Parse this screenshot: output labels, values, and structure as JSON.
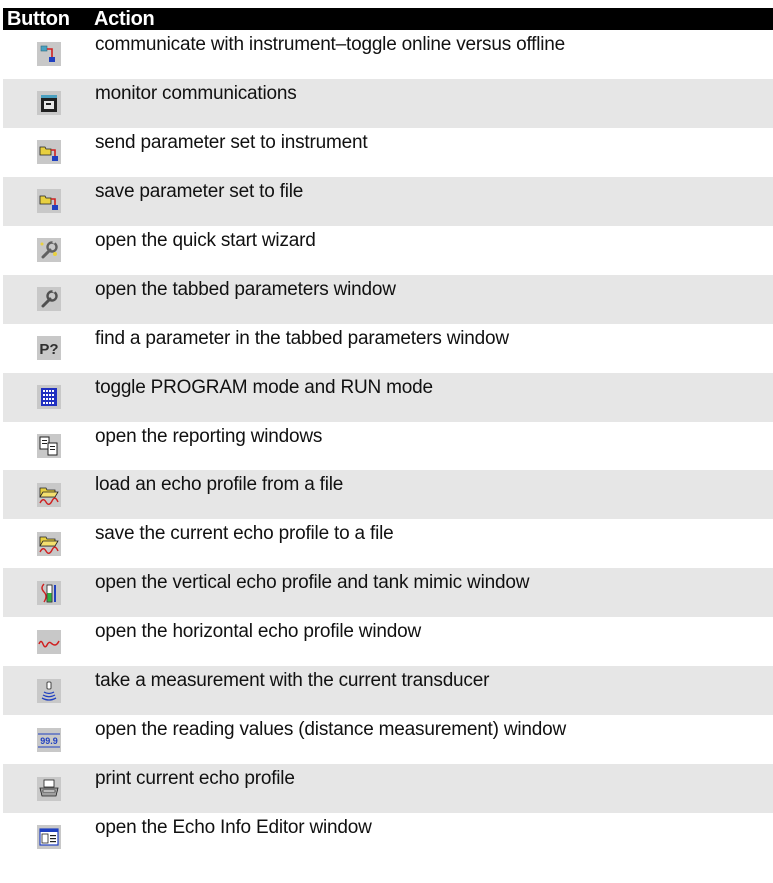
{
  "header": {
    "button": "Button",
    "action": "Action"
  },
  "rows": [
    {
      "icon": "online-toggle-icon",
      "text": "communicate with instrument–toggle online versus offline"
    },
    {
      "icon": "monitor-communications-icon",
      "text": "monitor communications"
    },
    {
      "icon": "send-parameters-icon",
      "text": "send parameter set to instrument"
    },
    {
      "icon": "save-parameters-icon",
      "text": "save parameter set to file"
    },
    {
      "icon": "quick-start-wizard-icon",
      "text": "open the quick start wizard"
    },
    {
      "icon": "wrench-icon",
      "text": "open the tabbed parameters window"
    },
    {
      "icon": "find-parameter-icon",
      "text": "find a parameter in the tabbed parameters window"
    },
    {
      "icon": "keypad-icon",
      "text": "toggle PROGRAM mode and RUN mode"
    },
    {
      "icon": "reporting-windows-icon",
      "text": "open the reporting windows"
    },
    {
      "icon": "load-echo-profile-icon",
      "text": "load an echo profile from a file"
    },
    {
      "icon": "save-echo-profile-icon",
      "text": "save the current echo profile to a file"
    },
    {
      "icon": "vertical-echo-profile-icon",
      "text": "open the vertical echo profile and tank mimic window"
    },
    {
      "icon": "horizontal-echo-profile-icon",
      "text": "open the horizontal echo profile window"
    },
    {
      "icon": "transducer-measurement-icon",
      "text": "take a measurement with the current transducer"
    },
    {
      "icon": "reading-values-icon",
      "text": "open the reading values (distance measurement) window"
    },
    {
      "icon": "printer-icon",
      "text": "print current echo profile"
    },
    {
      "icon": "echo-info-editor-icon",
      "text": "open the Echo Info Editor window"
    }
  ],
  "icon_texts": {
    "find_parameter": "P?",
    "reading_values": "99.9"
  },
  "colors": {
    "header_bg": "#000000",
    "row_shade": "#e6e6e6",
    "icon_bg": "#c8c8c8"
  }
}
